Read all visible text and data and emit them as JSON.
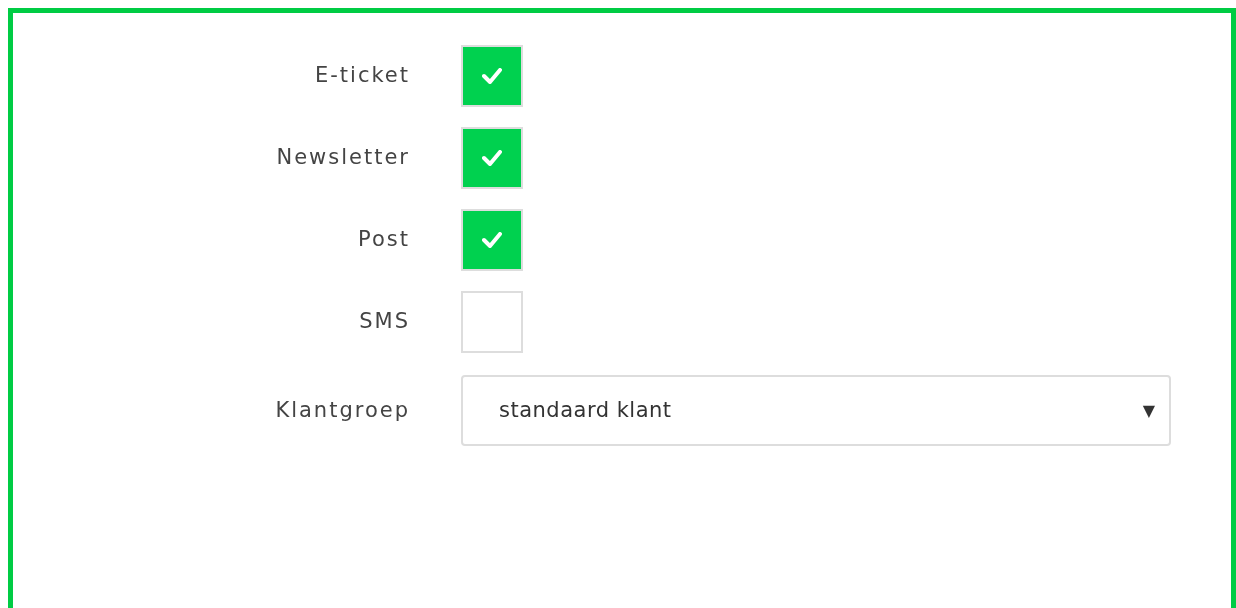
{
  "fields": [
    {
      "kind": "checkbox",
      "label": "E-ticket",
      "checked": true
    },
    {
      "kind": "checkbox",
      "label": "Newsletter",
      "checked": true
    },
    {
      "kind": "checkbox",
      "label": "Post",
      "checked": true
    },
    {
      "kind": "checkbox",
      "label": "SMS",
      "checked": false
    },
    {
      "kind": "select",
      "label": "Klantgroep",
      "value": "standaard klant",
      "arrow": "▼"
    }
  ]
}
